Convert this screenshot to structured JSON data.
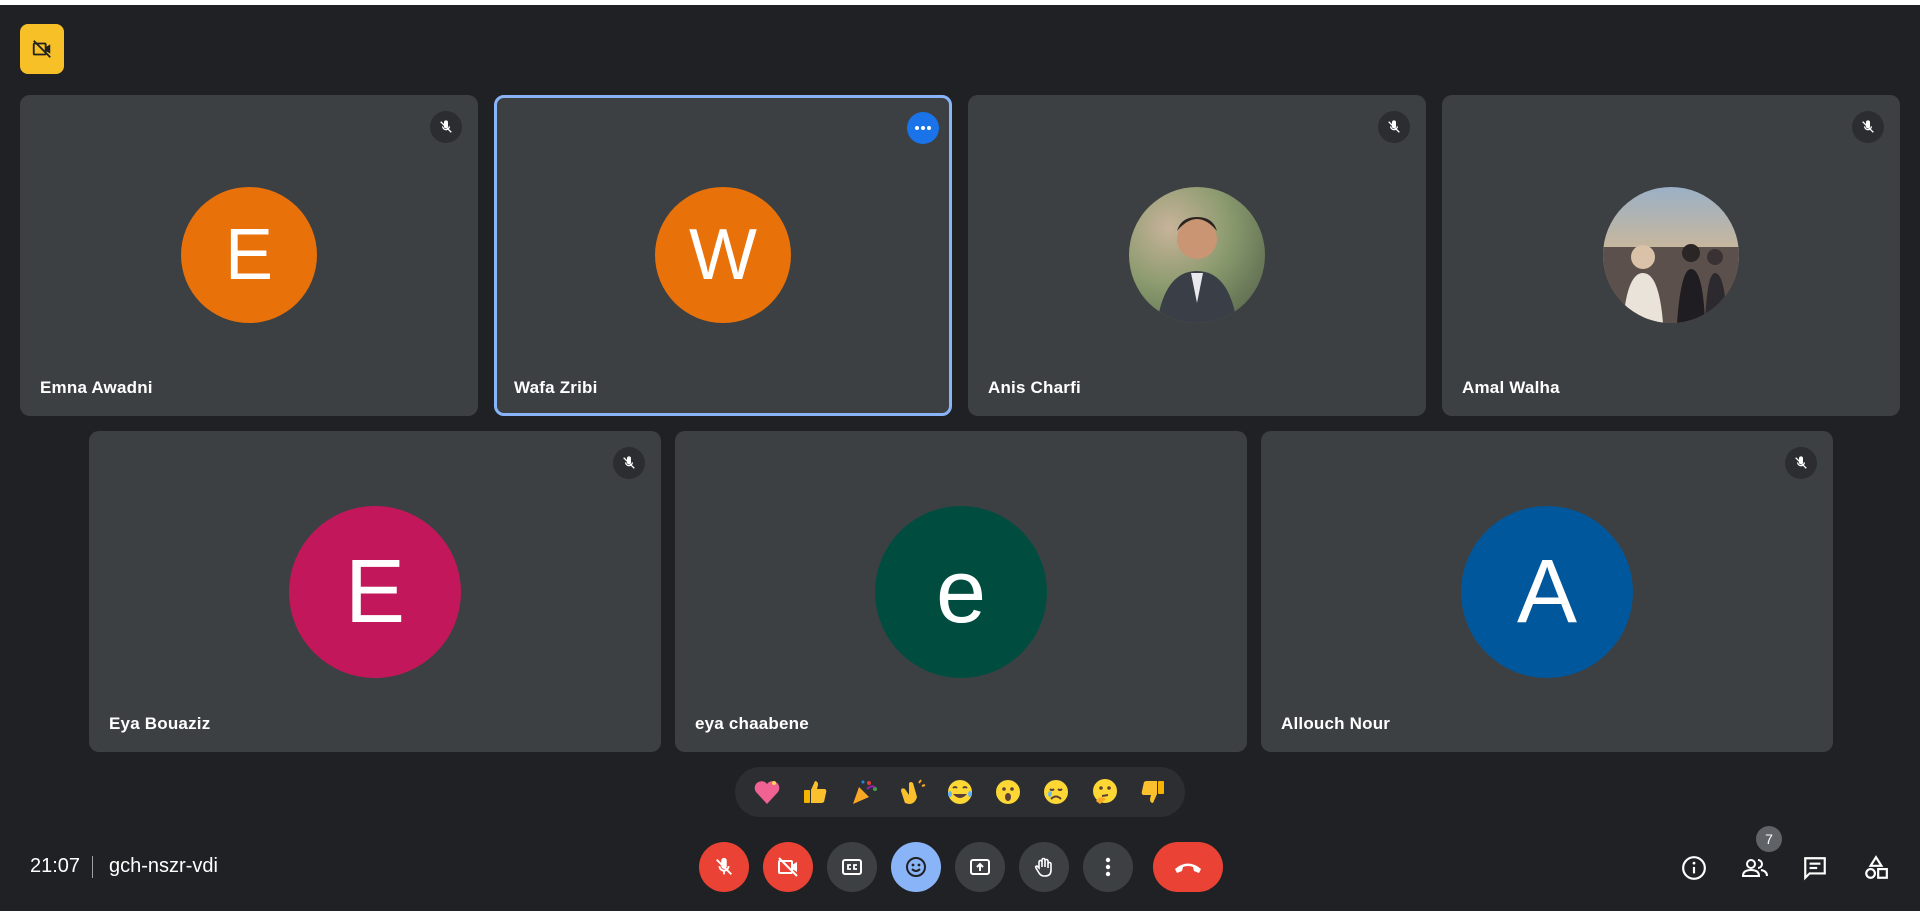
{
  "meeting": {
    "time": "21:07",
    "code": "gch-nszr-vdi",
    "participant_count": "7"
  },
  "participants": [
    {
      "name": "Emna Awadni",
      "initial": "E",
      "avatar_color": "#e8710a",
      "muted": true,
      "photo": false
    },
    {
      "name": "Wafa Zribi",
      "initial": "W",
      "avatar_color": "#e8710a",
      "muted": false,
      "photo": false,
      "speaking": true
    },
    {
      "name": "Anis Charfi",
      "initial": "",
      "avatar_color": "#6b7a60",
      "muted": true,
      "photo": true
    },
    {
      "name": "Amal Walha",
      "initial": "",
      "avatar_color": "#7a6f6a",
      "muted": true,
      "photo": true
    },
    {
      "name": "Eya Bouaziz",
      "initial": "E",
      "avatar_color": "#c2185b",
      "muted": true,
      "photo": false
    },
    {
      "name": "eya chaabene",
      "initial": "e",
      "avatar_color": "#004d40",
      "muted": false,
      "photo": false
    },
    {
      "name": "Allouch Nour",
      "initial": "A",
      "avatar_color": "#01579b",
      "muted": true,
      "photo": false
    }
  ],
  "reactions": [
    {
      "name": "sparkling-heart",
      "glyph": "💖"
    },
    {
      "name": "thumbs-up",
      "glyph": "👍"
    },
    {
      "name": "party-popper",
      "glyph": "🎉"
    },
    {
      "name": "clapping-hands",
      "glyph": "👏"
    },
    {
      "name": "tears-of-joy",
      "glyph": "😂"
    },
    {
      "name": "surprised",
      "glyph": "😮"
    },
    {
      "name": "crying",
      "glyph": "😢"
    },
    {
      "name": "thinking",
      "glyph": "🤔"
    },
    {
      "name": "thumbs-down",
      "glyph": "👎"
    }
  ],
  "colors": {
    "background": "#202124",
    "tile": "#3c4043",
    "active_border": "#8ab4f8",
    "danger": "#ea4335",
    "accent": "#1a73e8",
    "warning_badge": "#f6c026"
  }
}
